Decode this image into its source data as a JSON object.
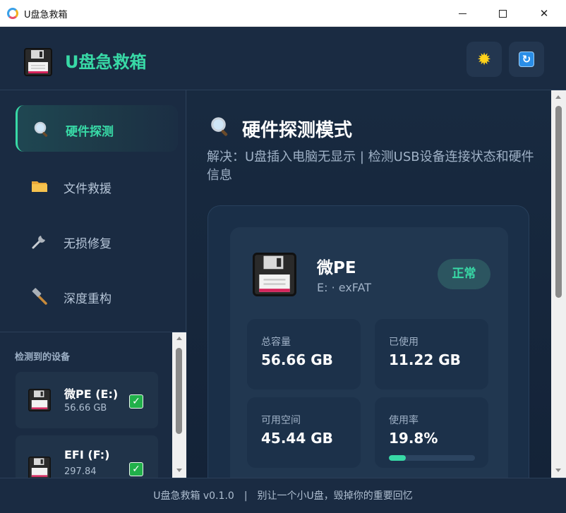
{
  "window": {
    "title": "U盘急救箱"
  },
  "header": {
    "brand": "U盘急救箱",
    "theme_icon": "sun-icon",
    "refresh_icon": "refresh-icon"
  },
  "sidebar": {
    "items": [
      {
        "label": "硬件探测",
        "icon": "magnifier-icon",
        "active": true
      },
      {
        "label": "文件救援",
        "icon": "folder-icon",
        "active": false
      },
      {
        "label": "无损修复",
        "icon": "wrench-icon",
        "active": false
      },
      {
        "label": "深度重构",
        "icon": "hammer-icon",
        "active": false
      }
    ],
    "devices_title": "检测到的设备",
    "devices": [
      {
        "name": "微PE (E:)",
        "size": "56.66 GB",
        "checked": true
      },
      {
        "name": "EFI (F:)",
        "size": "297.84",
        "checked": true
      }
    ]
  },
  "main": {
    "title": "硬件探测模式",
    "description": "解决：U盘插入电脑无显示 | 检测USB设备连接状态和硬件信息",
    "drive": {
      "name": "微PE",
      "meta": "E: · exFAT",
      "status": "正常",
      "stats": {
        "total_label": "总容量",
        "total_value": "56.66 GB",
        "used_label": "已使用",
        "used_value": "11.22 GB",
        "free_label": "可用空间",
        "free_value": "45.44 GB",
        "usage_label": "使用率",
        "usage_value": "19.8%",
        "usage_fraction": 0.198
      }
    }
  },
  "footer": {
    "version": "U盘急救箱 v0.1.0",
    "separator": "|",
    "slogan": "别让一个小U盘，毁掉你的重要回忆"
  },
  "colors": {
    "accent": "#38d9a6",
    "background": "#1a2b42",
    "card": "#213750",
    "check": "#21b04a"
  }
}
